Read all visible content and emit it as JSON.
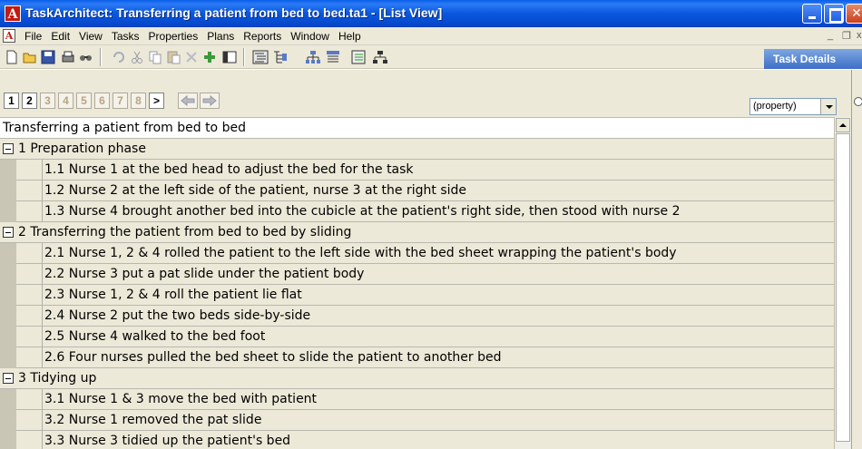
{
  "window": {
    "title": "TaskArchitect: Transferring a patient from bed to bed.ta1 - [List View]",
    "logo_letter": "A"
  },
  "menu": {
    "items": [
      "File",
      "Edit",
      "View",
      "Tasks",
      "Properties",
      "Plans",
      "Reports",
      "Window",
      "Help"
    ],
    "mdi_min": "_",
    "mdi_restore": "❐",
    "mdi_close": "x"
  },
  "toolbar": {
    "icons": [
      "new-icon",
      "open-icon",
      "save-icon",
      "print-icon",
      "find-icon",
      "undo-icon",
      "cut-icon",
      "copy-icon",
      "paste-icon",
      "delete-icon",
      "add-icon",
      "panel-icon",
      "outline-icon",
      "tree-icon",
      "hierarchy-icon",
      "diagram-icon",
      "list-icon",
      "org-icon"
    ],
    "task_details_label": "Task Details"
  },
  "levels": {
    "buttons": [
      "1",
      "2",
      "3",
      "4",
      "5",
      "6",
      "7",
      "8",
      ">"
    ],
    "active_count": 2
  },
  "property_select": {
    "value": "(property)"
  },
  "list": {
    "root": "Transferring a patient from bed to bed",
    "phases": [
      {
        "label": "1  Preparation phase",
        "tasks": [
          "1.1 Nurse 1 at the bed head to adjust the bed for the task",
          "1.2 Nurse 2 at the left side of the patient, nurse 3 at the right side",
          "1.3 Nurse 4 brought another bed into the cubicle at the patient's right side, then stood with nurse 2"
        ]
      },
      {
        "label": "2 Transferring the patient from bed to bed by sliding",
        "tasks": [
          "2.1 Nurse 1, 2 & 4 rolled the patient to the left side with the bed sheet wrapping the patient's body",
          "2.2 Nurse 3 put a pat slide under the patient body",
          "2.3 Nurse 1, 2 & 4 roll the patient lie flat",
          "2.4 Nurse 2 put the two beds side-by-side",
          "2.5 Nurse 4 walked to the bed foot",
          "2.6 Four nurses pulled the bed sheet to slide the patient to another bed"
        ]
      },
      {
        "label": "3 Tidying up",
        "tasks": [
          "3.1 Nurse 1 & 3 move the bed with patient",
          "3.2 Nurse 1 removed the pat slide",
          "3.3 Nurse 3 tidied up the patient's bed"
        ]
      }
    ]
  }
}
